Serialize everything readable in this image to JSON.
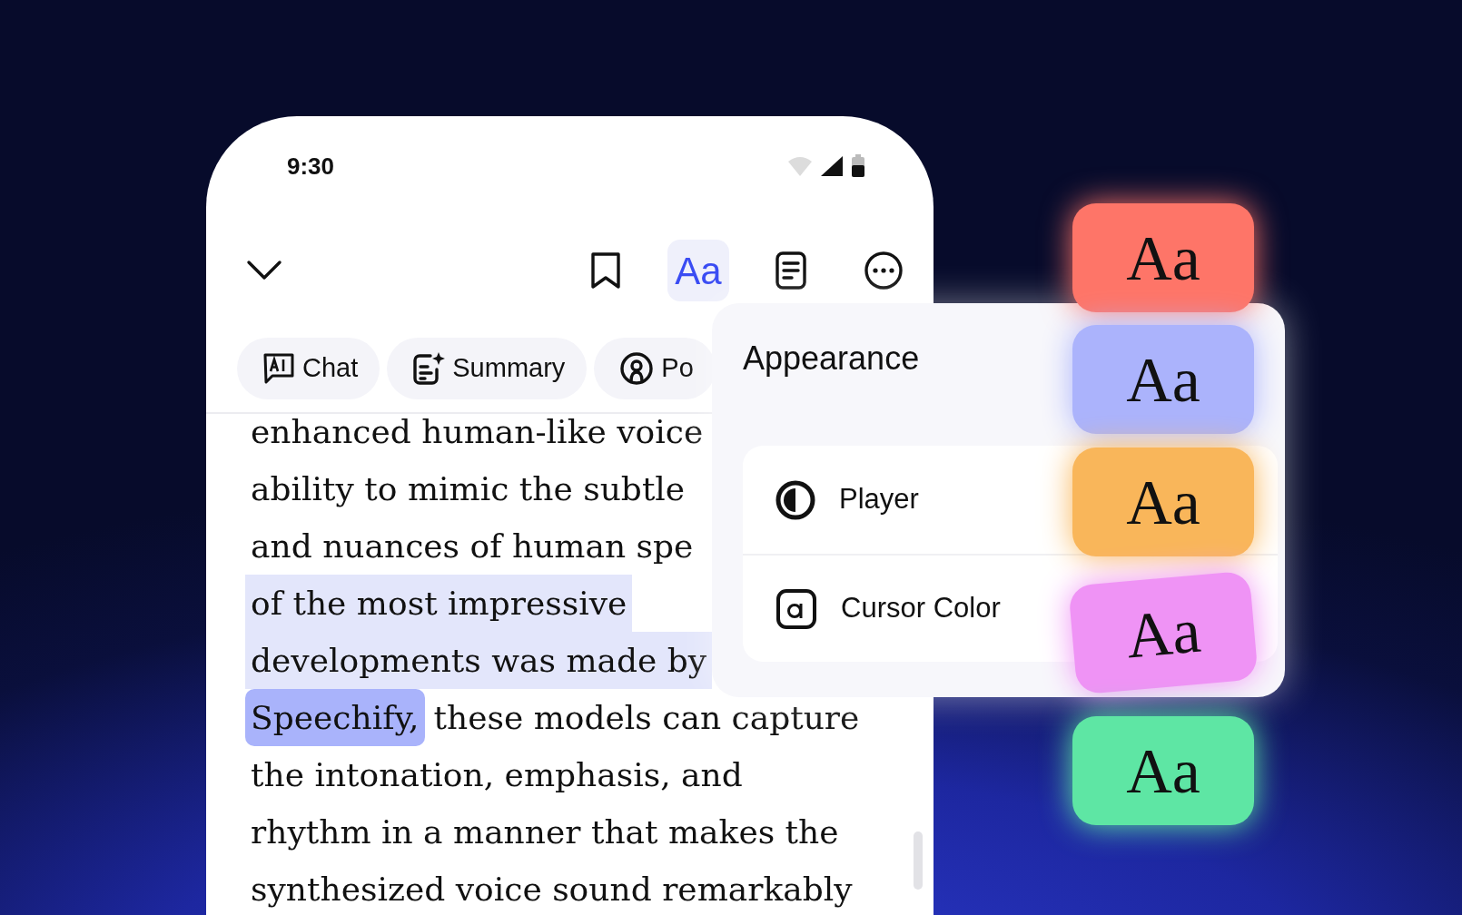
{
  "status_bar": {
    "time": "9:30"
  },
  "toolbar": [
    {
      "kind": "chevron",
      "selected": false
    },
    {
      "kind": "bookmark",
      "selected": false
    },
    {
      "kind": "text",
      "label": "Aa",
      "selected": true
    },
    {
      "kind": "document",
      "selected": false
    },
    {
      "kind": "more",
      "selected": false
    }
  ],
  "chips": [
    {
      "kind": "chat",
      "label": "Chat"
    },
    {
      "kind": "summary",
      "label": "Summary"
    },
    {
      "kind": "podcast",
      "label": "Po"
    }
  ],
  "lines": [
    {
      "segments": [
        {
          "text": "enhanced human-like voice",
          "kind": "plain"
        }
      ]
    },
    {
      "segments": [
        {
          "text": "ability to mimic the subtle",
          "kind": "plain"
        }
      ]
    },
    {
      "segments": [
        {
          "text": "and nuances of human spe",
          "kind": "plain"
        }
      ]
    },
    {
      "segments": [
        {
          "text": "of the most impressive",
          "kind": "sentence"
        }
      ]
    },
    {
      "segments": [
        {
          "text": "developments was made by",
          "kind": "sentence"
        }
      ]
    },
    {
      "segments": [
        {
          "text": "Speechify,",
          "kind": "word"
        },
        {
          "text": "these models can capture",
          "kind": "plain"
        }
      ]
    },
    {
      "segments": [
        {
          "text": "the intonation, emphasis, and",
          "kind": "plain"
        }
      ]
    },
    {
      "segments": [
        {
          "text": "rhythm in a manner that makes the",
          "kind": "plain"
        }
      ]
    },
    {
      "segments": [
        {
          "text": "synthesized voice sound remarkably",
          "kind": "plain"
        }
      ]
    }
  ],
  "appearance": {
    "title": "Appearance",
    "rows": [
      {
        "kind": "player",
        "label": "Player"
      },
      {
        "kind": "cursor",
        "label": "Cursor Color"
      }
    ]
  },
  "font_cards": [
    {
      "label": "Aa",
      "color": "#fe7568"
    },
    {
      "label": "Aa",
      "color": "#abb3fc"
    },
    {
      "label": "Aa",
      "color": "#f9b65a"
    },
    {
      "label": "Aa",
      "color": "#ef93f5"
    },
    {
      "label": "Aa",
      "color": "#5ee6a4"
    }
  ]
}
